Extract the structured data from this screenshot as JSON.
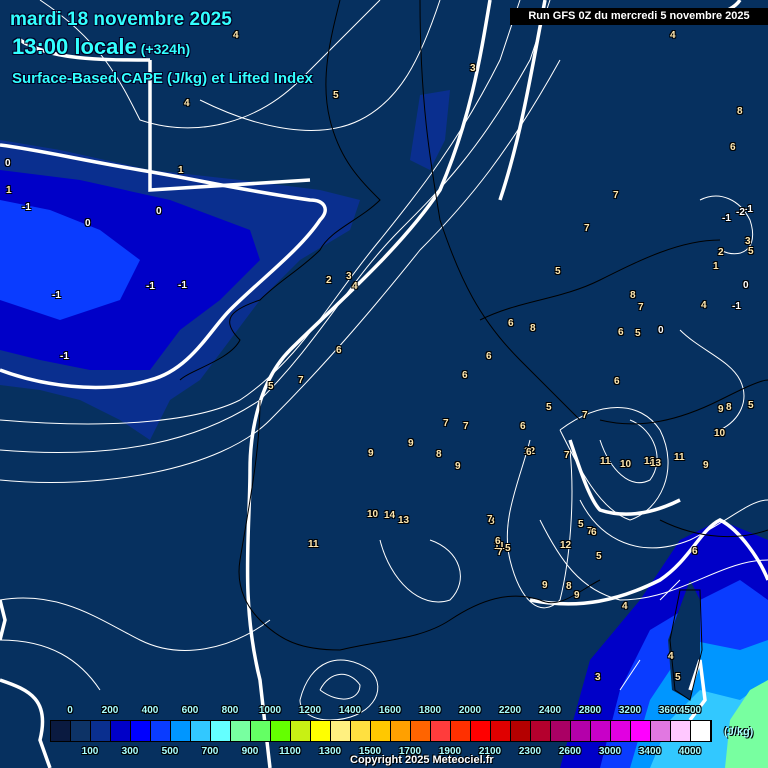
{
  "header": {
    "date": "mardi 18 novembre 2025",
    "time": "13:00 locale",
    "lead": "(+324h)",
    "parameter": "Surface-Based CAPE (J/kg) et Lifted Index",
    "run": "Run GFS 0Z du mercredi 5 novembre 2025"
  },
  "legend": {
    "unit": "(J/kg)",
    "top_ticks": [
      "0",
      "200",
      "400",
      "600",
      "800",
      "1000",
      "1200",
      "1400",
      "1600",
      "1800",
      "2000",
      "2200",
      "2400",
      "2800",
      "3200",
      "3600",
      "4500"
    ],
    "bottom_ticks": [
      "100",
      "300",
      "500",
      "700",
      "900",
      "1100",
      "1300",
      "1500",
      "1700",
      "1900",
      "2100",
      "2300",
      "2600",
      "3000",
      "3400",
      "4000"
    ],
    "colors": [
      "#0a1a40",
      "#0d3366",
      "#0a2f8f",
      "#0000c8",
      "#0000ff",
      "#0a3cff",
      "#0096ff",
      "#32c8ff",
      "#64ffff",
      "#78ffa0",
      "#64ff64",
      "#64ff00",
      "#c8f014",
      "#ffff00",
      "#fff080",
      "#ffe040",
      "#ffc800",
      "#ffa000",
      "#ff6400",
      "#ff3c3c",
      "#ff3000",
      "#ff0000",
      "#e00000",
      "#b40000",
      "#b4002d",
      "#aa0064",
      "#b400aa",
      "#c800c8",
      "#e100e1",
      "#ff00ff",
      "#e178e1",
      "#ffc8ff",
      "#ffffff"
    ]
  },
  "lifted_index_labels": [
    "4",
    "5",
    "4",
    "3",
    "4",
    "8",
    "6",
    "7",
    "0",
    "1",
    "-1",
    "0",
    "0",
    "1",
    "-1",
    "-1",
    "-1",
    "-1",
    "2",
    "3",
    "4",
    "6",
    "6",
    "6",
    "6",
    "5",
    "7",
    "5",
    "7",
    "6",
    "8",
    "7",
    "6",
    "5",
    "7",
    "7",
    "8",
    "9",
    "9",
    "10",
    "11",
    "14",
    "13",
    "12",
    "11",
    "11",
    "10",
    "12",
    "13",
    "11",
    "9",
    "10",
    "9",
    "8",
    "5",
    "5",
    "3",
    "2",
    "1",
    "-1",
    "0",
    "-1",
    "-2",
    "-1",
    "0",
    "4",
    "8",
    "6",
    "5",
    "7",
    "7",
    "7",
    "6",
    "5",
    "8",
    "9",
    "12",
    "5",
    "4",
    "3",
    "6",
    "4",
    "5",
    "9",
    "8",
    "6",
    "7",
    "7",
    "5",
    "6",
    "9"
  ],
  "copyright": "Copyright 2025 Meteociel.fr",
  "colors": {
    "background": "#06305f",
    "title": "#33ffff"
  }
}
